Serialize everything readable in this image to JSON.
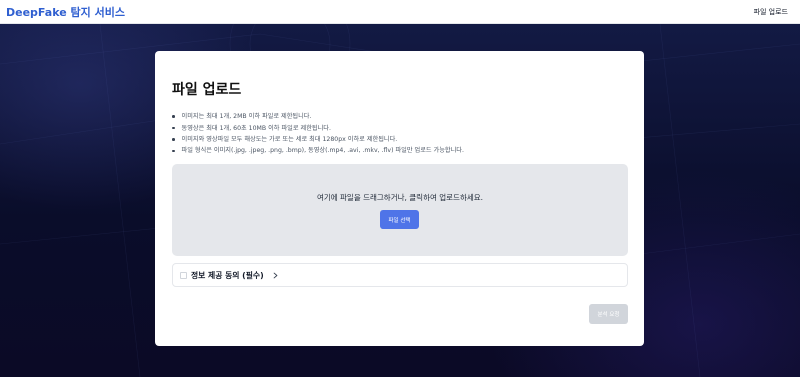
{
  "navbar": {
    "brand": "DeepFake 탐지 서비스",
    "upload_link": "파일 업로드"
  },
  "card": {
    "title": "파일 업로드",
    "rules": [
      "이미지는 최대 1개, 2MB 이하 파일로 제한됩니다.",
      "동영상은 최대 1개, 60초 10MB 이하 파일로 제한됩니다.",
      "이미지와 영상파일 모두 해상도는 가로 또는 세로 최대 1280px 이하로 제한됩니다.",
      "파일 형식은 이미지(.jpg, .jpeg, .png, .bmp), 동영상(.mp4, .avi, .mkv, .flv) 파일만 업로드 가능합니다."
    ],
    "dropzone": {
      "text": "여기에 파일을 드래그하거나, 클릭하여 업로드하세요.",
      "select_button": "파일 선택"
    },
    "consent": {
      "label": "정보 제공 동의 (필수)",
      "checked": false
    },
    "submit_button": "분석 요청"
  },
  "colors": {
    "brand": "#2f5fd0",
    "primary_button": "#4f74e8",
    "disabled_button": "#d1d5db",
    "dropzone_bg": "#e5e7eb"
  }
}
